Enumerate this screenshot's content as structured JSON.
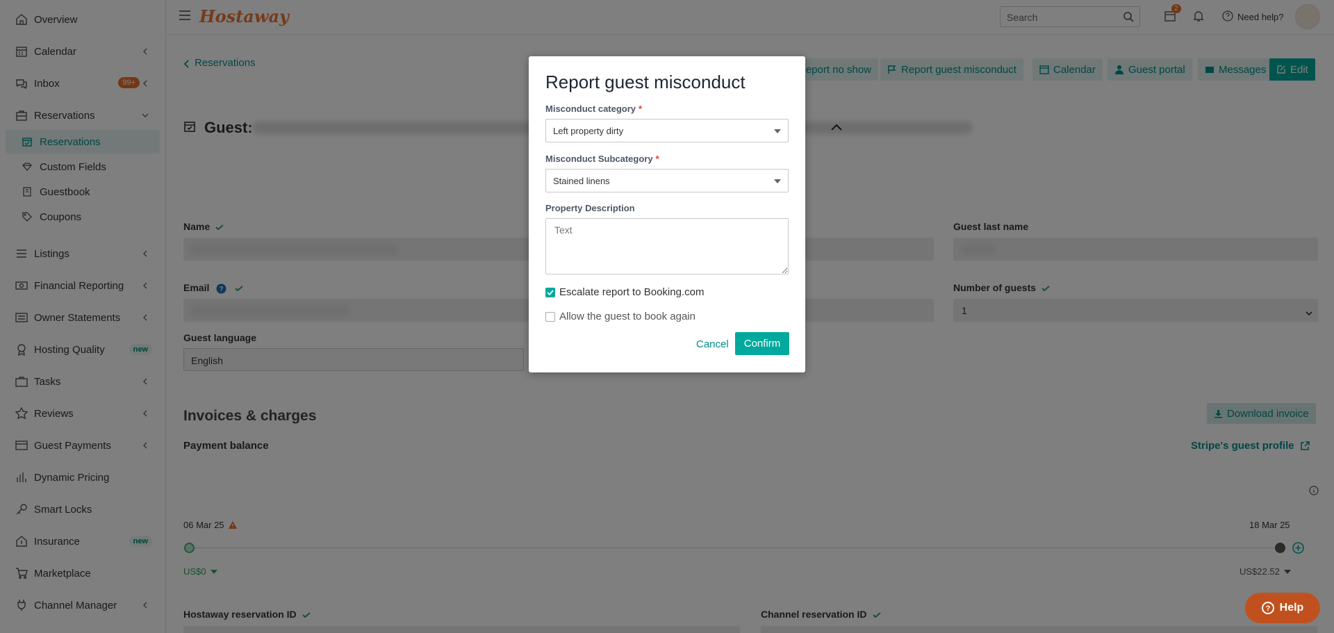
{
  "sidebar": {
    "items": [
      {
        "label": "Overview",
        "icon": "home-icon"
      },
      {
        "label": "Calendar",
        "icon": "calendar-icon"
      },
      {
        "label": "Inbox",
        "icon": "chat-icon",
        "badge": "99+"
      },
      {
        "label": "Reservations",
        "icon": "suitcase-icon"
      },
      {
        "label": "Listings",
        "icon": "list-icon"
      },
      {
        "label": "Financial Reporting",
        "icon": "money-icon"
      },
      {
        "label": "Owner Statements",
        "icon": "statement-icon"
      },
      {
        "label": "Hosting Quality",
        "icon": "trophy-icon",
        "badge": "new"
      },
      {
        "label": "Tasks",
        "icon": "briefcase-icon"
      },
      {
        "label": "Reviews",
        "icon": "star-icon"
      },
      {
        "label": "Guest Payments",
        "icon": "card-icon"
      },
      {
        "label": "Dynamic Pricing",
        "icon": "bars-icon"
      },
      {
        "label": "Smart Locks",
        "icon": "key-icon"
      },
      {
        "label": "Insurance",
        "icon": "house-shield-icon",
        "badge": "new"
      },
      {
        "label": "Marketplace",
        "icon": "cart-icon"
      },
      {
        "label": "Channel Manager",
        "icon": "plug-icon"
      }
    ],
    "reservations_sub": [
      {
        "label": "Reservations"
      },
      {
        "label": "Custom Fields"
      },
      {
        "label": "Guestbook"
      },
      {
        "label": "Coupons"
      }
    ]
  },
  "header": {
    "logo": "Hostaway",
    "search_placeholder": "Search",
    "cal_badge": "2",
    "need_help": "Need help?"
  },
  "page": {
    "back_link": "Reservations",
    "guest_label": "Guest:",
    "toolbar": {
      "report_no_show": "Report no show",
      "report_misconduct": "Report guest misconduct",
      "calendar": "Calendar",
      "guest_portal": "Guest portal",
      "messages": "Messages",
      "edit": "Edit"
    },
    "fields": {
      "name": "Name",
      "guest_last_name": "Guest last name",
      "email": "Email",
      "number_of_guests": "Number of guests",
      "number_of_guests_value": "1",
      "guest_language": "Guest language",
      "guest_language_value": "English"
    },
    "invoices": {
      "title": "Invoices & charges",
      "download": "Download invoice",
      "payment_balance": "Payment balance",
      "stripe_profile": "Stripe's guest profile",
      "start_date": "06 Mar 25",
      "end_date": "18 Mar 25",
      "start_amount": "US$0",
      "end_amount": "US$22.52",
      "hostaway_id": "Hostaway reservation ID",
      "channel_id": "Channel reservation ID"
    },
    "help_button": "Help"
  },
  "modal": {
    "title": "Report guest misconduct",
    "category_label": "Misconduct category",
    "category_value": "Left property dirty",
    "subcategory_label": "Misconduct Subcategory",
    "subcategory_value": "Stained linens",
    "description_label": "Property Description",
    "description_placeholder": "Text",
    "escalate_label": "Escalate report to Booking.com",
    "escalate_checked": true,
    "allow_label": "Allow the guest to book again",
    "allow_checked": false,
    "cancel": "Cancel",
    "confirm": "Confirm",
    "required_mark": "*"
  },
  "colors": {
    "teal": "#00a99d",
    "teal_text": "#008d86",
    "orange": "#e86f2a"
  }
}
